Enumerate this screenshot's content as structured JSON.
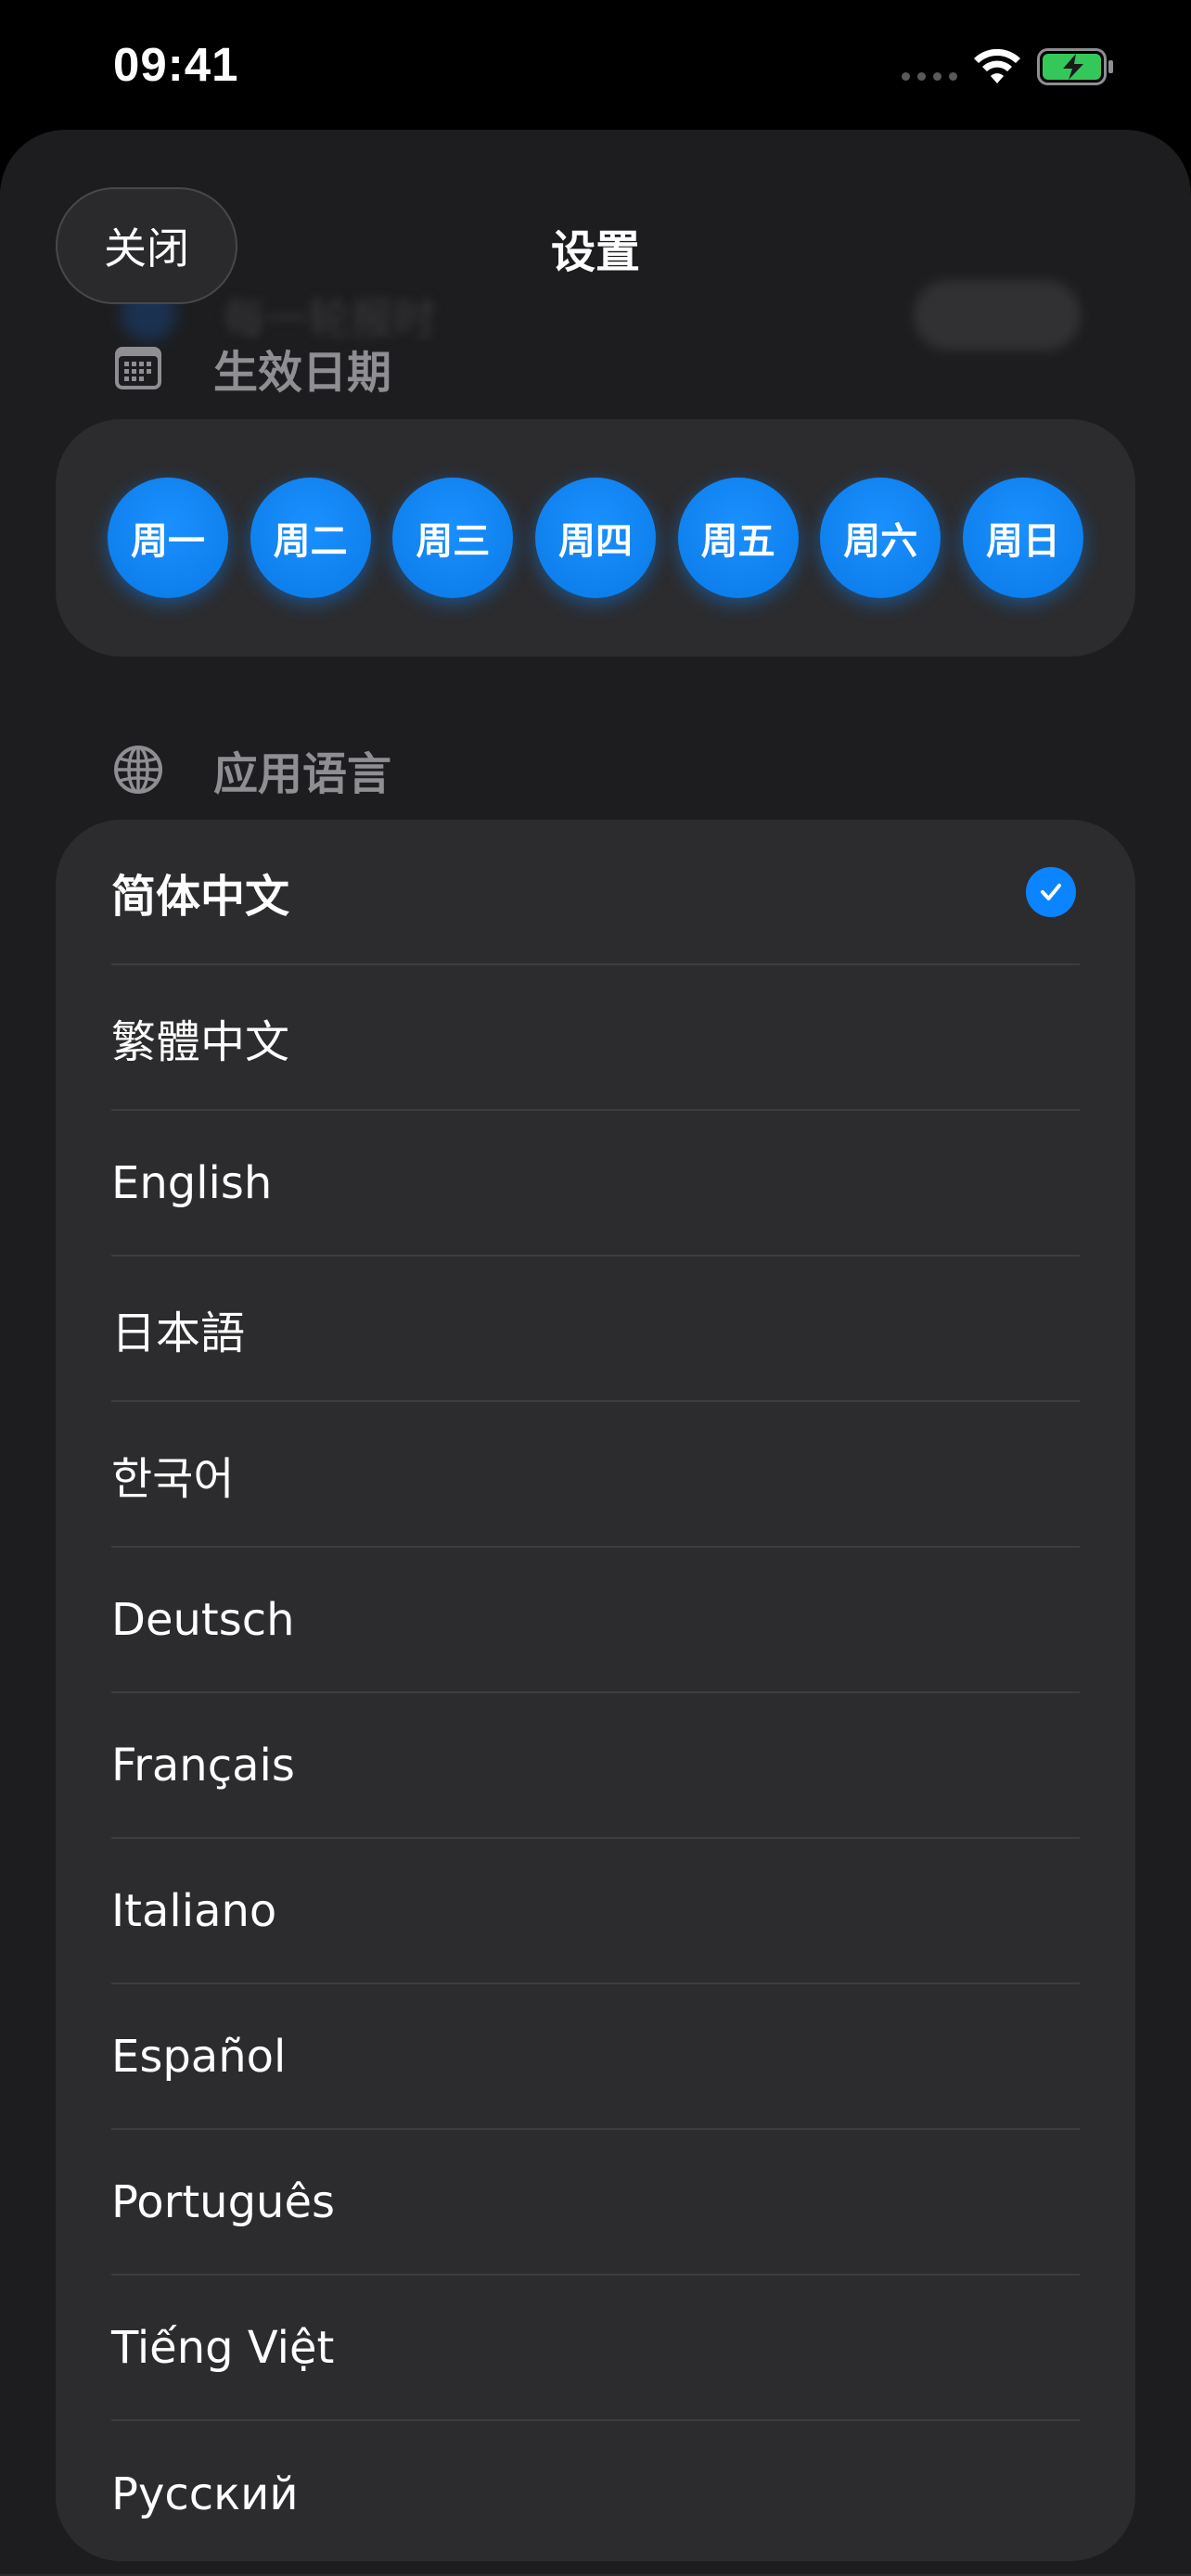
{
  "status": {
    "time": "09:41"
  },
  "header": {
    "title": "设置",
    "close_label": "关闭"
  },
  "background_row": {
    "label": "每一轮报时"
  },
  "effective_date": {
    "header": "生效日期",
    "icon": "calendar-icon",
    "days": [
      "周一",
      "周二",
      "周三",
      "周四",
      "周五",
      "周六",
      "周日"
    ]
  },
  "app_language": {
    "header": "应用语言",
    "icon": "globe-icon",
    "selected_index": 0,
    "options": [
      "简体中文",
      "繁體中文",
      "English",
      "日本語",
      "한국어",
      "Deutsch",
      "Français",
      "Italiano",
      "Español",
      "Português",
      "Tiếng Việt",
      "Русский"
    ]
  },
  "colors": {
    "accent": "#0A84FF",
    "battery": "#34C759",
    "sheet_bg": "#1D1D1F",
    "card_bg": "#2C2C2E",
    "secondary_text": "#8E8E93"
  }
}
